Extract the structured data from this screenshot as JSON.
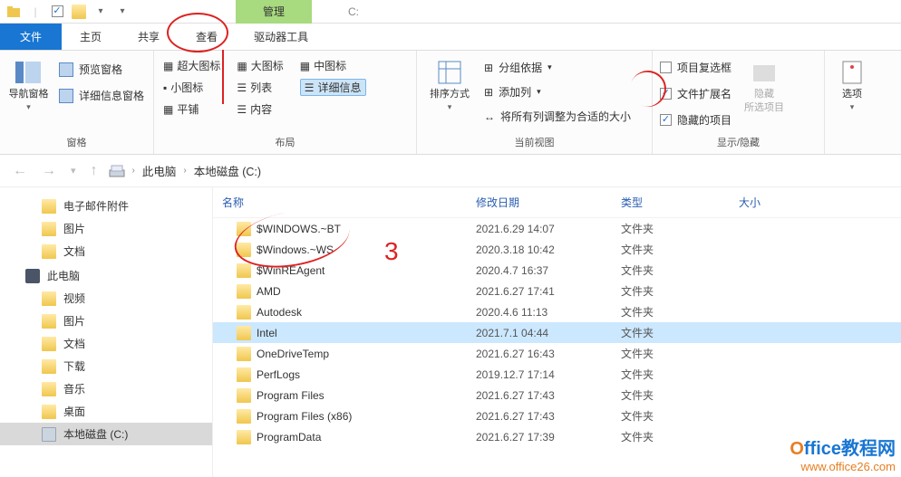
{
  "titlebar": {
    "context_tab": "管理",
    "placeholder": "C:"
  },
  "tabs": {
    "file": "文件",
    "home": "主页",
    "share": "共享",
    "view": "查看",
    "drive": "驱动器工具"
  },
  "ribbon": {
    "panes": {
      "nav": "导航窗格",
      "preview": "预览窗格",
      "details": "详细信息窗格",
      "group_label": "窗格"
    },
    "layout": {
      "xl": "超大图标",
      "lg": "大图标",
      "md": "中图标",
      "sm": "小图标",
      "list": "列表",
      "detail": "详细信息",
      "tiles": "平铺",
      "content": "内容",
      "group_label": "布局"
    },
    "view": {
      "sort": "排序方式",
      "group": "分组依据",
      "addcol": "添加列",
      "fit": "将所有列调整为合适的大小",
      "group_label": "当前视图"
    },
    "show": {
      "itemcheck": "项目复选框",
      "ext": "文件扩展名",
      "hidden": "隐藏的项目",
      "hide": "隐藏",
      "hide_sub": "所选项目",
      "group_label": "显示/隐藏"
    },
    "options": "选项"
  },
  "breadcrumb": {
    "pc": "此电脑",
    "drive": "本地磁盘 (C:)"
  },
  "sidebar": {
    "items": [
      {
        "label": "电子邮件附件",
        "icon": "folder",
        "lvl": 1
      },
      {
        "label": "图片",
        "icon": "folder",
        "lvl": 1
      },
      {
        "label": "文档",
        "icon": "folder",
        "lvl": 1
      },
      {
        "label": "此电脑",
        "icon": "pc",
        "lvl": 0
      },
      {
        "label": "视频",
        "icon": "folder",
        "lvl": 1
      },
      {
        "label": "图片",
        "icon": "folder",
        "lvl": 1
      },
      {
        "label": "文档",
        "icon": "folder",
        "lvl": 1
      },
      {
        "label": "下载",
        "icon": "folder",
        "lvl": 1
      },
      {
        "label": "音乐",
        "icon": "folder",
        "lvl": 1
      },
      {
        "label": "桌面",
        "icon": "folder",
        "lvl": 1
      },
      {
        "label": "本地磁盘 (C:)",
        "icon": "drive",
        "lvl": 1,
        "selected": true
      }
    ]
  },
  "columns": {
    "name": "名称",
    "date": "修改日期",
    "type": "类型",
    "size": "大小"
  },
  "files": [
    {
      "name": "$WINDOWS.~BT",
      "date": "2021.6.29 14:07",
      "type": "文件夹"
    },
    {
      "name": "$Windows.~WS",
      "date": "2020.3.18 10:42",
      "type": "文件夹"
    },
    {
      "name": "$WinREAgent",
      "date": "2020.4.7 16:37",
      "type": "文件夹"
    },
    {
      "name": "AMD",
      "date": "2021.6.27 17:41",
      "type": "文件夹"
    },
    {
      "name": "Autodesk",
      "date": "2020.4.6 11:13",
      "type": "文件夹"
    },
    {
      "name": "Intel",
      "date": "2021.7.1 04:44",
      "type": "文件夹",
      "selected": true
    },
    {
      "name": "OneDriveTemp",
      "date": "2021.6.27 16:43",
      "type": "文件夹"
    },
    {
      "name": "PerfLogs",
      "date": "2019.12.7 17:14",
      "type": "文件夹"
    },
    {
      "name": "Program Files",
      "date": "2021.6.27 17:43",
      "type": "文件夹"
    },
    {
      "name": "Program Files (x86)",
      "date": "2021.6.27 17:43",
      "type": "文件夹"
    },
    {
      "name": "ProgramData",
      "date": "2021.6.27 17:39",
      "type": "文件夹"
    }
  ],
  "annotations": {
    "num3": "3"
  },
  "watermark": {
    "line1a": "O",
    "line1b": "ffice教程网",
    "line2": "www.office26.com"
  }
}
